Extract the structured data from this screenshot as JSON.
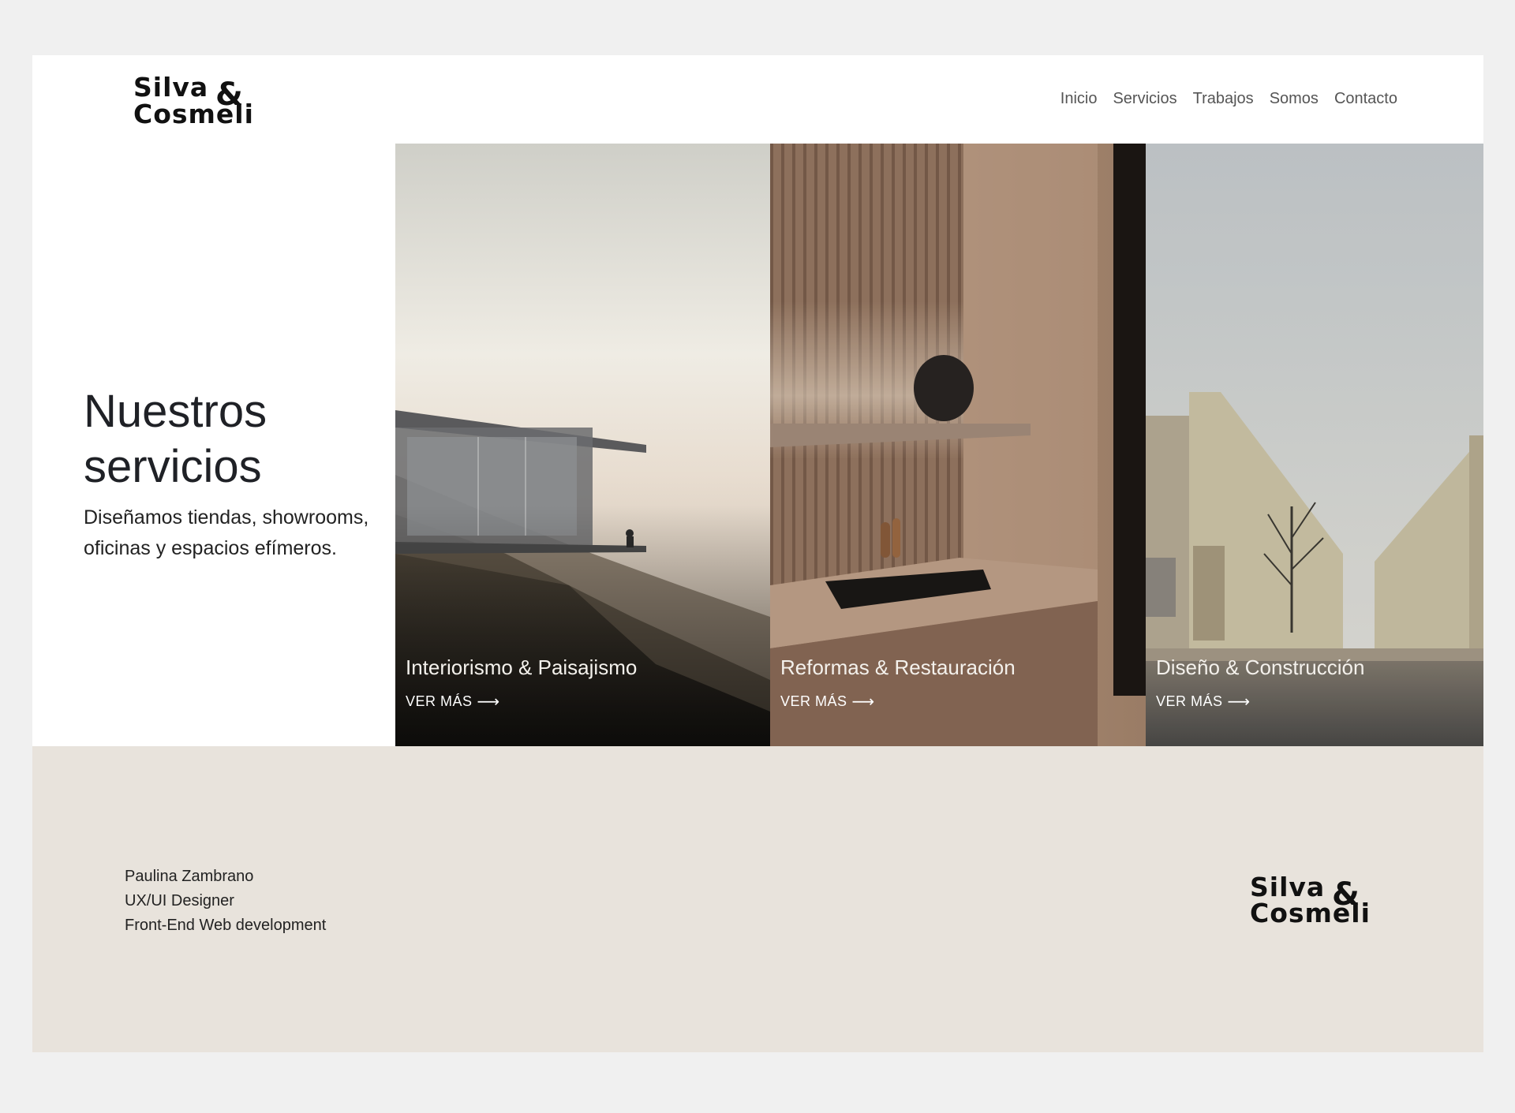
{
  "header": {
    "logo": {
      "line1": "Silva",
      "amp": "&",
      "line2": "Cosmeli"
    },
    "nav": [
      "Inicio",
      "Servicios",
      "Trabajos",
      "Somos",
      "Contacto"
    ]
  },
  "hero": {
    "title_line1": "Nuestros",
    "title_line2": "servicios",
    "description": "Diseñamos tiendas, showrooms, oficinas y espacios efímeros."
  },
  "services": [
    {
      "title": "Interiorismo & Paisajismo",
      "link": "VER MÁS",
      "arrow": "⟶"
    },
    {
      "title": "Reformas & Restauración",
      "link": "VER MÁS",
      "arrow": "⟶"
    },
    {
      "title": "Diseño & Construcción",
      "link": "VER MÁS",
      "arrow": "⟶"
    }
  ],
  "footer": {
    "credits": [
      "Paulina Zambrano",
      "UX/UI Designer",
      "Front-End Web development"
    ],
    "logo": {
      "line1": "Silva",
      "amp": "&",
      "line2": "Cosmeli"
    }
  },
  "colors": {
    "background": "#f0f0f0",
    "page": "#ffffff",
    "footer": "#e8e3dc",
    "text": "#222222"
  }
}
